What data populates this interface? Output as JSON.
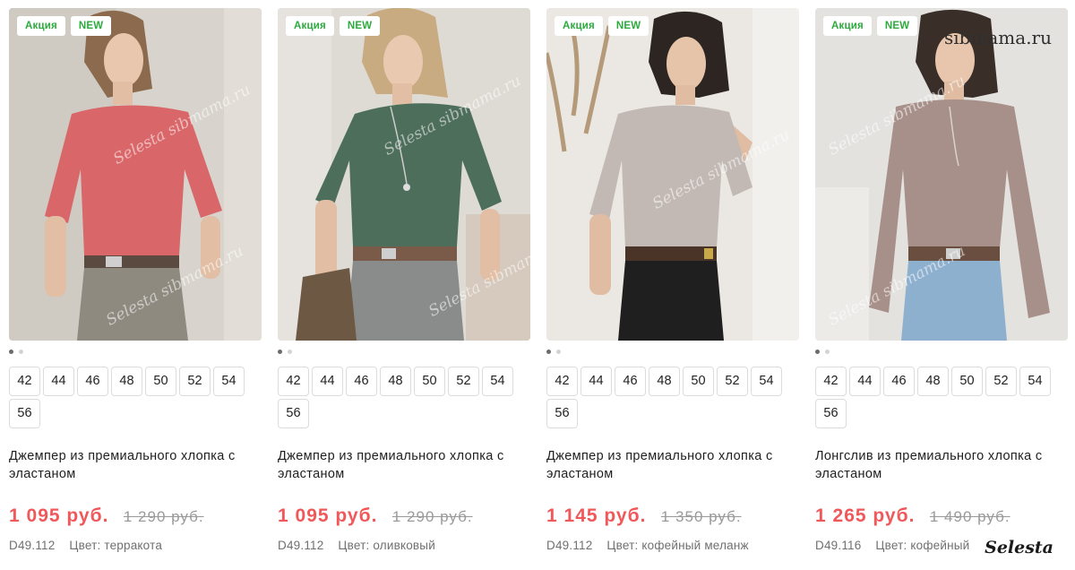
{
  "badges": {
    "sale": "Акция",
    "new": "NEW"
  },
  "products": [
    {
      "title": "Джемпер из премиального хлопка с эластаном",
      "price": "1 095 руб.",
      "old_price": "1 290 руб.",
      "article": "D49.112",
      "color_text": "Цвет: терракота",
      "sizes": [
        "42",
        "44",
        "46",
        "48",
        "50",
        "52",
        "54",
        "56"
      ],
      "image_count": 2,
      "active_image": 1,
      "shirt_color": "#d9676a"
    },
    {
      "title": "Джемпер из премиального хлопка с эластаном",
      "price": "1 095 руб.",
      "old_price": "1 290 руб.",
      "article": "D49.112",
      "color_text": "Цвет: оливковый",
      "sizes": [
        "42",
        "44",
        "46",
        "48",
        "50",
        "52",
        "54",
        "56"
      ],
      "image_count": 2,
      "active_image": 1,
      "shirt_color": "#4e6e5c"
    },
    {
      "title": "Джемпер из премиального хлопка с эластаном",
      "price": "1 145 руб.",
      "old_price": "1 350 руб.",
      "article": "D49.112",
      "color_text": "Цвет: кофейный меланж",
      "sizes": [
        "42",
        "44",
        "46",
        "48",
        "50",
        "52",
        "54",
        "56"
      ],
      "image_count": 2,
      "active_image": 1,
      "shirt_color": "#c2b9b4"
    },
    {
      "title": "Лонгслив из премиального хлопка с эластаном",
      "price": "1 265 руб.",
      "old_price": "1 490 руб.",
      "article": "D49.116",
      "color_text": "Цвет: кофейный",
      "sizes": [
        "42",
        "44",
        "46",
        "48",
        "50",
        "52",
        "54",
        "56"
      ],
      "image_count": 2,
      "active_image": 1,
      "shirt_color": "#a8908a"
    }
  ],
  "watermarks": {
    "site": "sibmama.ru",
    "image_mark": "Selesta sibmama.ru",
    "corner": "Selesta"
  },
  "colors": {
    "badge_green": "#2cab3d",
    "price_red": "#f0585a",
    "muted": "#9a9a9a"
  }
}
